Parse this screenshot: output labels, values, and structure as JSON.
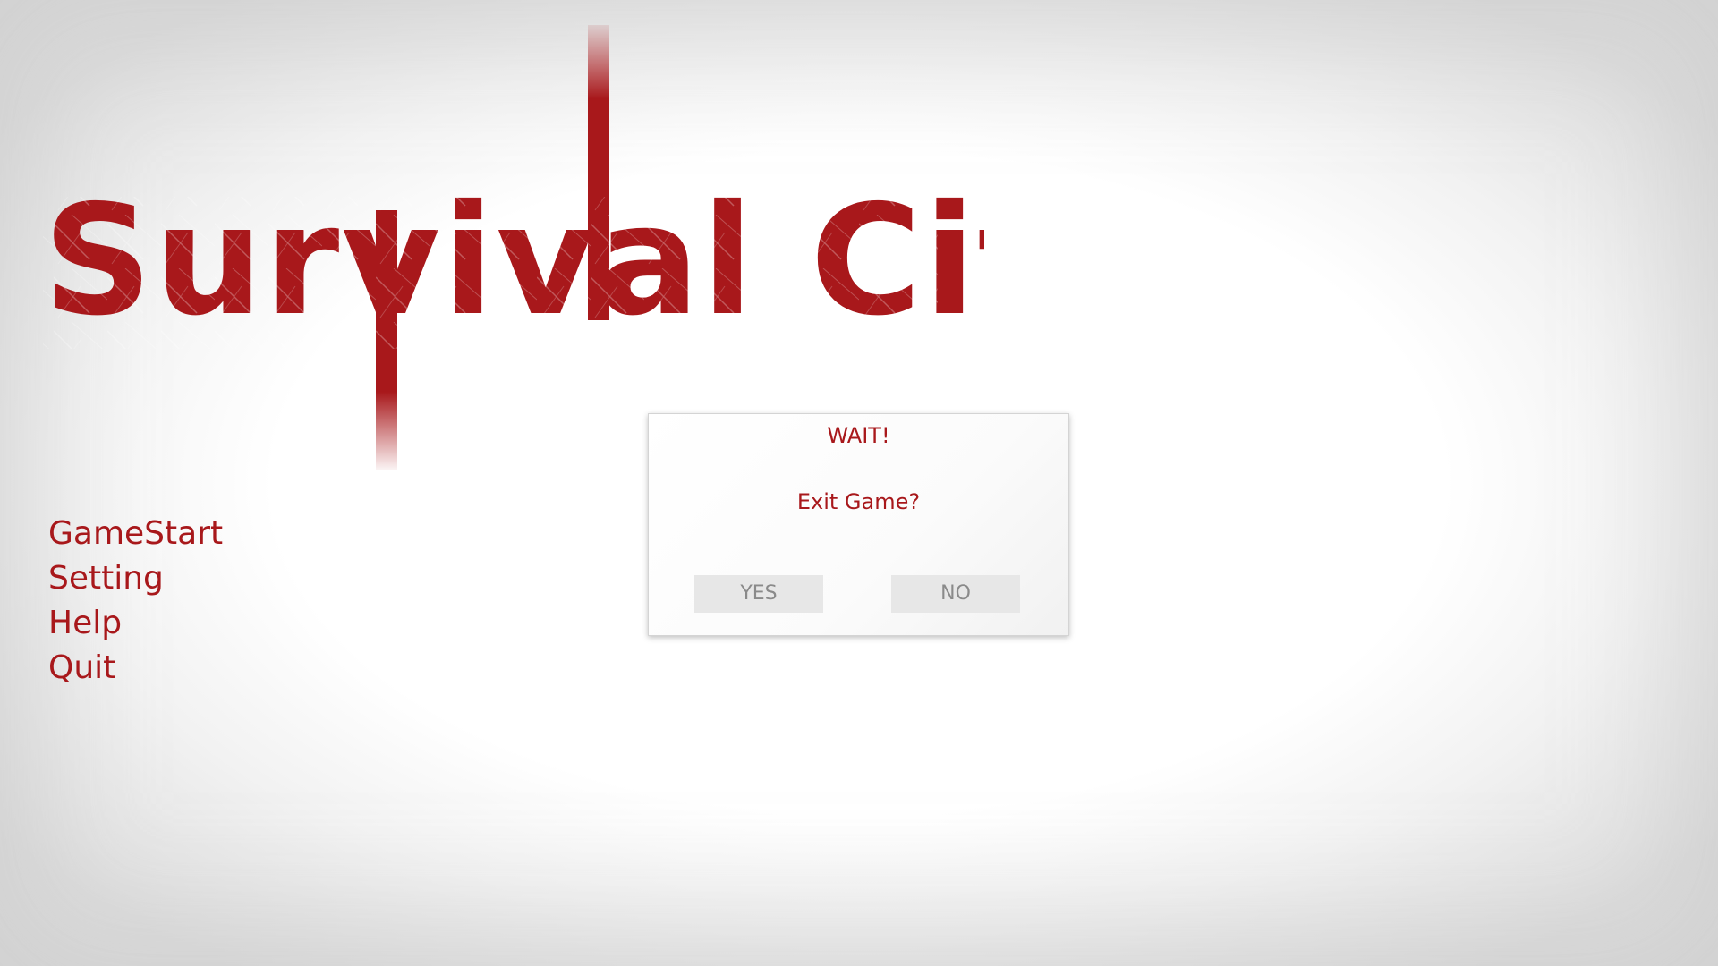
{
  "game": {
    "title": "Survival City"
  },
  "menu": {
    "items": [
      {
        "label": "GameStart"
      },
      {
        "label": "Setting"
      },
      {
        "label": "Help"
      },
      {
        "label": "Quit"
      }
    ]
  },
  "dialog": {
    "title": "WAIT!",
    "message": "Exit Game?",
    "yes_label": "YES",
    "no_label": "NO"
  },
  "colors": {
    "accent": "#a8181b",
    "button_bg": "#e7e7e7",
    "button_text": "#8a8a8a"
  }
}
